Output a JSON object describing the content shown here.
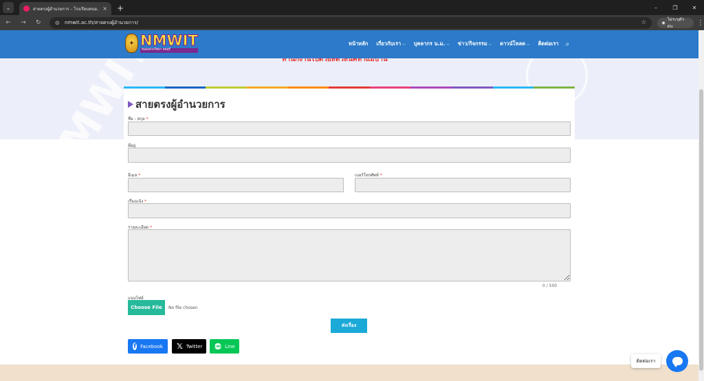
{
  "browser": {
    "tab_title": "สายตรงผู้อำนวยการ – โรงเรียนหนอ...",
    "url": "nmwit.ac.th/สายตรงผู้อำนวยการ/",
    "profile_label": "ไม่ระบุตัวตน",
    "tab_menu_icon": "⌄",
    "tab_close_icon": "×",
    "new_tab_icon": "+",
    "minimize_icon": "–",
    "restore_icon": "❐",
    "close_icon": "✕",
    "back_icon": "←",
    "forward_icon": "→",
    "reload_icon": "↻",
    "site_info_icon": "⚙",
    "star_icon": "☆",
    "profile_icon": "◉",
    "menu_icon": "⋮"
  },
  "site": {
    "logo_big": "NMWIT",
    "logo_small": "หนองม่วงวิทยา ลพบุรี",
    "logo_seal": "✦",
    "search_icon": "⌕",
    "chevron": "⌵",
    "nav": [
      {
        "label": "หน้าหลัก",
        "has_submenu": false
      },
      {
        "label": "เกี่ยวกับเรา",
        "has_submenu": true
      },
      {
        "label": "บุคลากร น.ม.",
        "has_submenu": true
      },
      {
        "label": "ข่าว/กิจกรรม",
        "has_submenu": true
      },
      {
        "label": "ดาวน์โหลด",
        "has_submenu": true
      },
      {
        "label": "ติดต่อเรา",
        "has_submenu": false
      }
    ],
    "banner_text": "ทำนักงานไปด้วยสัตว์สินค์ทาแม้บ้าน",
    "watermark_text": "NMWIT"
  },
  "colors": {
    "header": "#2c7ac9",
    "accent_purple": "#7e57c2",
    "file_button": "#26b99a",
    "submit_button": "#1ba9d8",
    "facebook": "#1877f2",
    "twitter": "#000000",
    "line": "#06c755",
    "stripe": [
      "#29b6f6",
      "#1565c0",
      "#c0ca33",
      "#f9a825",
      "#fb8c00",
      "#e53935",
      "#ec407a",
      "#ab47bc",
      "#7e57c2",
      "#29b6f6",
      "#7cb342"
    ]
  },
  "form": {
    "title": "สายตรงผู้อำนวยการ",
    "required_mark": "*",
    "fields": {
      "name": {
        "label": "ชื่อ - สกุล",
        "value": ""
      },
      "address": {
        "label": "ที่อยู่",
        "value": ""
      },
      "email": {
        "label": "อีเมล",
        "value": ""
      },
      "phone": {
        "label": "เบอร์โทรศัพท์",
        "value": ""
      },
      "subject": {
        "label": "เรื่องแจ้ง",
        "value": ""
      },
      "details": {
        "label": "รายละเอียด",
        "value": "",
        "counter": "0 / 500"
      },
      "attachment": {
        "label": "แนบไฟล์",
        "button": "Choose File",
        "status": "No file chosen"
      }
    },
    "submit_label": "ส่งเรื่อง"
  },
  "share": {
    "facebook": "Facebook",
    "twitter": "Twitter",
    "line": "Line",
    "facebook_icon": "f",
    "twitter_icon": "𝕏",
    "line_icon": "LINE"
  },
  "chat": {
    "label": "ติดต่อเรา"
  }
}
